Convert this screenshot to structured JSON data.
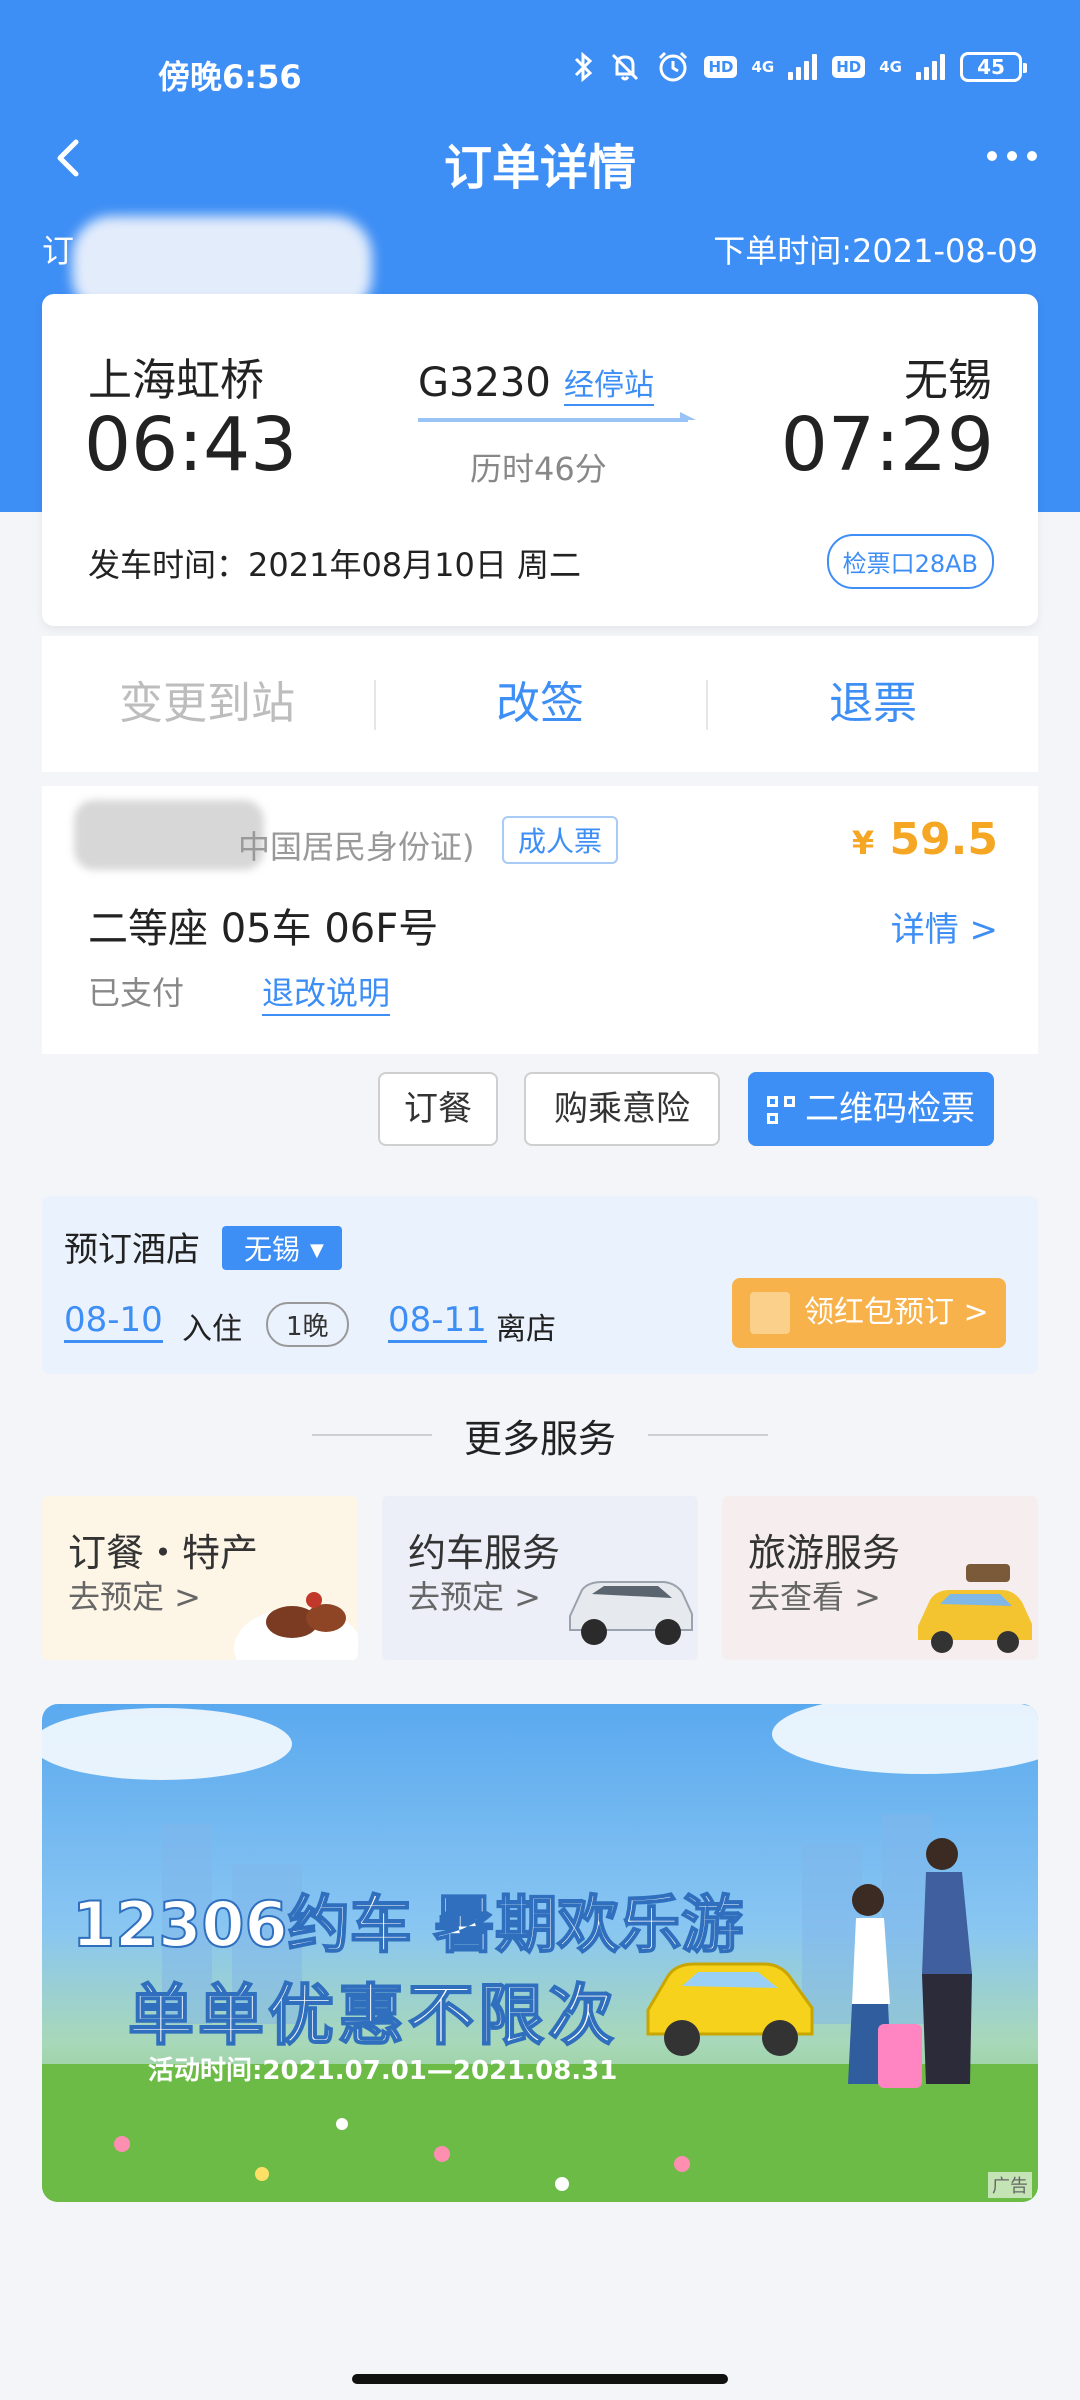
{
  "status_bar": {
    "time": "傍晚6:56",
    "signal_tag": "4G",
    "hd_label": "HD",
    "battery": "45"
  },
  "nav": {
    "title": "订单详情"
  },
  "order_info": {
    "order_prefix": "订",
    "order_time": "下单时间:2021-08-09"
  },
  "trip": {
    "from_station": "上海虹桥",
    "to_station": "无锡",
    "depart_time": "06:43",
    "arrive_time": "07:29",
    "train_no": "G3230",
    "via_stops_link": "经停站",
    "duration": "历时46分",
    "depart_date": "发车时间：2021年08月10日 周二",
    "gate": "检票口28AB"
  },
  "actions": {
    "change_station": "变更到站",
    "reschedule": "改签",
    "refund": "退票"
  },
  "passenger": {
    "id_type": "中国居民身份证)",
    "ticket_type": "成人票",
    "currency": "¥",
    "price": "59.5",
    "seat": "二等座 05车 06F号",
    "detail_link": "详情 >",
    "paid_status": "已支付",
    "rules_link": "退改说明"
  },
  "ticket_buttons": {
    "meal": "订餐",
    "insurance": "购乘意险",
    "qr_check": "二维码检票"
  },
  "hotel": {
    "title": "预订酒店",
    "city": "无锡",
    "checkin_date": "08-10",
    "checkin_label": "入住",
    "nights": "1晚",
    "checkout_date": "08-11",
    "checkout_label": "离店",
    "book_button": "领红包预订 >"
  },
  "more_services": {
    "title": "更多服务",
    "items": [
      {
        "title": "订餐・特产",
        "link": "去预定 >"
      },
      {
        "title": "约车服务",
        "link": "去预定 >"
      },
      {
        "title": "旅游服务",
        "link": "去查看 >"
      }
    ]
  },
  "banner": {
    "line1_a": "12306约车",
    "line1_b": "暑期欢乐游",
    "line2": "单单优惠不限次",
    "line3": "活动时间:2021.07.01—2021.08.31",
    "ad_tag": "广告"
  },
  "colors": {
    "brand_blue": "#3d8ef5",
    "price_orange": "#f5a623",
    "hotel_button": "#f7b24c"
  }
}
